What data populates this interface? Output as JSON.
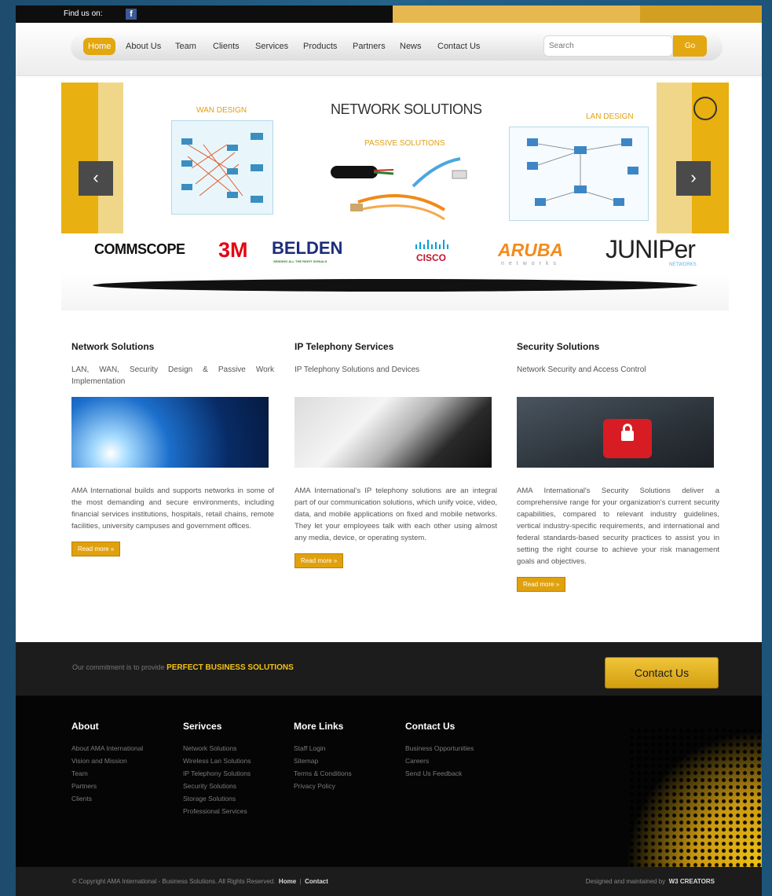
{
  "topbar": {
    "find_label": "Find us on:",
    "fb_icon": "facebook-icon"
  },
  "nav": {
    "items": [
      "Home",
      "About Us",
      "Team",
      "Clients",
      "Services",
      "Products",
      "Partners",
      "News",
      "Contact Us"
    ],
    "active": "Home",
    "search_placeholder": "Search",
    "go_label": "Go"
  },
  "slider": {
    "heading": "NETWORK SOLUTIONS",
    "wan_label": "WAN DESIGN",
    "passive_label": "PASSIVE SOLUTIONS",
    "lan_label": "LAN DESIGN",
    "prev": "‹",
    "next": "›"
  },
  "partners": {
    "commscope": "COMMSCOPE",
    "three_m": "3M",
    "belden": "BELDEN",
    "belden_tag": "SENDING ALL THE RIGHT SIGNALS",
    "cisco": "CISCO",
    "aruba": "ARUBA",
    "aruba_tag": "networks",
    "juniper": "JUNIPer",
    "juniper_tag": "NETWORKS"
  },
  "columns": [
    {
      "title": "Network Solutions",
      "subtitle": "LAN, WAN, Security Design & Passive Work Implementation",
      "body": "AMA International builds and supports networks in some of the most demanding and secure environments, including financial services institutions, hospitals, retail chains, remote facilities, university campuses and government offices.",
      "more": "Read more »"
    },
    {
      "title": "IP Telephony Services",
      "subtitle": "IP Telephony Solutions and Devices",
      "body": "AMA International's IP telephony solutions are an integral part of our communication solutions, which unify voice, video, data, and mobile applications on fixed and mobile networks. They let your employees talk with each other using almost any media, device, or operating system.",
      "more": "Read more »"
    },
    {
      "title": "Security Solutions",
      "subtitle": "Network Security and Access Control",
      "body": "AMA International's Security Solutions deliver a comprehensive range for your organization's current security capabilities, compared to relevant industry guidelines, vertical industry-specific requirements, and international and federal standards-based security practices to assist you in setting the right course to achieve your risk management goals and objectives.",
      "more": "Read more »"
    }
  ],
  "commitment": {
    "text": "Our commitment is to provide",
    "highlight": "PERFECT BUSINESS SOLUTIONS",
    "button": "Contact Us"
  },
  "footer": {
    "about": {
      "title": "About",
      "links": [
        "About AMA International",
        "Vision and Mission",
        "Team",
        "Partners",
        "Clients"
      ]
    },
    "services": {
      "title": "Serivces",
      "links": [
        "Network Solutions",
        "Wireless Lan Solutions",
        "IP Telephony Solutions",
        "Security Solutions",
        "Storage Solutions",
        "Professional Services"
      ]
    },
    "more": {
      "title": "More Links",
      "links": [
        "Staff Login",
        "Sitemap",
        "Terms & Conditions",
        "Privacy Policy"
      ]
    },
    "contact": {
      "title": "Contact Us",
      "links": [
        "Business Opportunities",
        "Careers",
        "Send Us Feedback"
      ]
    }
  },
  "copyright": {
    "text": "© Copyright AMA International - Business Solutions. All Rights Reserved.",
    "home": "Home",
    "sep": "|",
    "contact": "Contact",
    "designed": "Designed and maintained by",
    "creator": "W3 CREATORS"
  },
  "colors": {
    "gold": "#e2a711",
    "dark": "#1c1c1c",
    "footer": "#050505"
  }
}
